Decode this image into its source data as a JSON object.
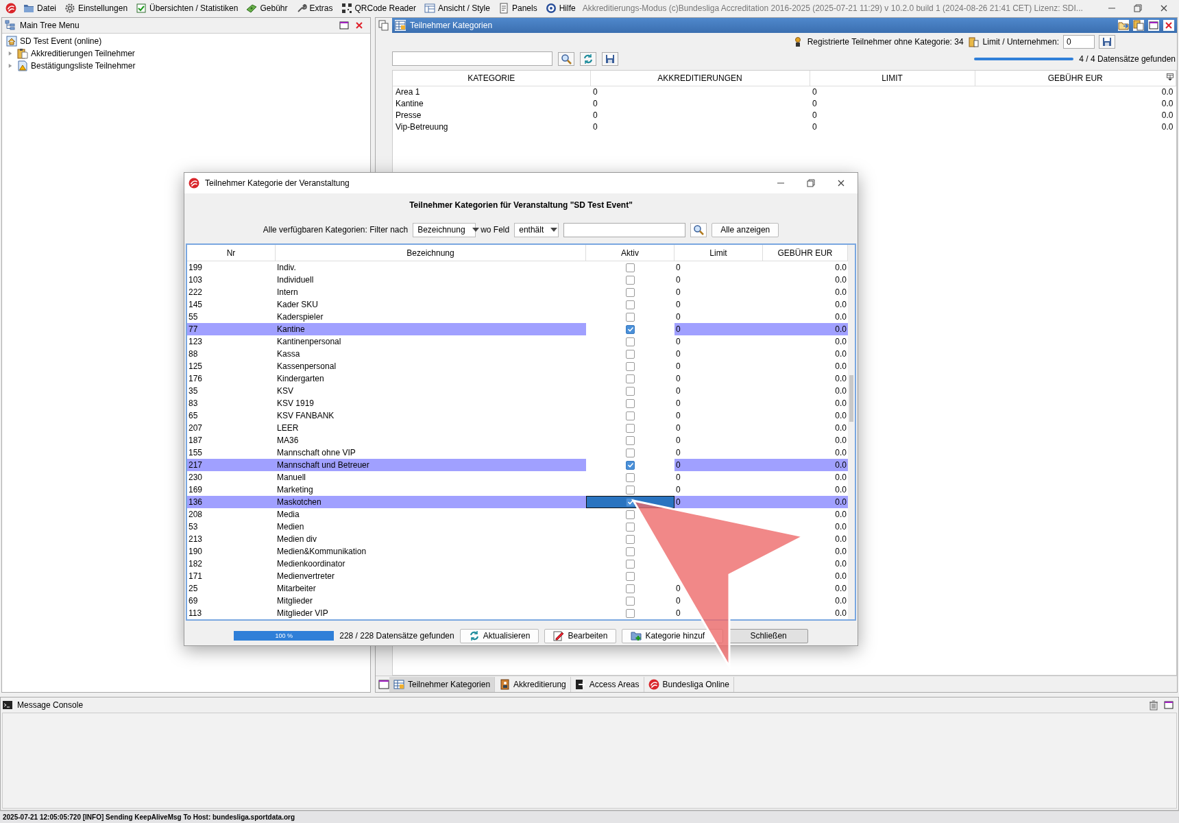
{
  "menu_bar": {
    "items": [
      {
        "label": "Datei"
      },
      {
        "label": "Einstellungen"
      },
      {
        "label": "Übersichten / Statistiken"
      },
      {
        "label": "Gebühr"
      },
      {
        "label": "Extras"
      },
      {
        "label": "QRCode Reader"
      },
      {
        "label": "Ansicht / Style"
      },
      {
        "label": "Panels"
      },
      {
        "label": "Hilfe"
      }
    ],
    "app_title": "Akkreditierungs-Modus (c)Bundesliga Accreditation 2016-2025 (2025-07-21 11:29) v 10.2.0 build 1 (2024-08-26 21:41 CET) Lizenz: SDI..."
  },
  "tree_panel": {
    "title": "Main Tree Menu",
    "root": "SD Test Event (online)",
    "items": [
      {
        "label": "Akkreditierungen Teilnehmer",
        "expanded": false
      },
      {
        "label": "Bestätigungsliste Teilnehmer",
        "expanded": false
      }
    ]
  },
  "main_panel": {
    "title": "Teilnehmer Kategorien",
    "info": "Registrierte Teilnehmer ohne Kategorie: 34",
    "limit_label": "Limit / Unternehmen:",
    "limit_value": "0",
    "progress": {
      "level": 1
    },
    "records": "4 / 4 Datensätze gefunden",
    "columns": [
      "KATEGORIE",
      "AKKREDITIERUNGEN",
      "LIMIT",
      "GEBÜHR EUR"
    ],
    "rows": [
      {
        "category": "Area 1",
        "accreditations": "0",
        "limit": "0",
        "fee": "0.0"
      },
      {
        "category": "Kantine",
        "accreditations": "0",
        "limit": "0",
        "fee": "0.0"
      },
      {
        "category": "Presse",
        "accreditations": "0",
        "limit": "0",
        "fee": "0.0"
      },
      {
        "category": "Vip-Betreuung",
        "accreditations": "0",
        "limit": "0",
        "fee": "0.0"
      }
    ],
    "tabs": [
      {
        "label": "Teilnehmer Kategorien",
        "selected": true
      },
      {
        "label": "Akkreditierung",
        "selected": false
      },
      {
        "label": "Access Areas",
        "selected": false
      },
      {
        "label": "Bundesliga Online",
        "selected": false
      }
    ]
  },
  "dialog": {
    "title": "Teilnehmer Kategorie der Veranstaltung",
    "heading": "Teilnehmer Kategorien für Veranstaltung \"SD Test Event\"",
    "filter_label": "Alle verfügbaren Kategorien: Filter nach",
    "field_select": "Bezeichnung",
    "field_label": "wo Feld",
    "operator_select": "enthält",
    "show_all_button": "Alle anzeigen",
    "columns": [
      "Nr",
      "Bezeichnung",
      "Aktiv",
      "Limit",
      "GEBÜHR EUR"
    ],
    "rows": [
      {
        "nr": "199",
        "name": "Indiv.",
        "active": false,
        "limit": "0",
        "fee": "0.0",
        "selected": false,
        "focused": false
      },
      {
        "nr": "103",
        "name": "Individuell",
        "active": false,
        "limit": "0",
        "fee": "0.0",
        "selected": false,
        "focused": false
      },
      {
        "nr": "222",
        "name": "Intern",
        "active": false,
        "limit": "0",
        "fee": "0.0",
        "selected": false,
        "focused": false
      },
      {
        "nr": "145",
        "name": "Kader SKU",
        "active": false,
        "limit": "0",
        "fee": "0.0",
        "selected": false,
        "focused": false
      },
      {
        "nr": "55",
        "name": "Kaderspieler",
        "active": false,
        "limit": "0",
        "fee": "0.0",
        "selected": false,
        "focused": false
      },
      {
        "nr": "77",
        "name": "Kantine",
        "active": true,
        "limit": "0",
        "fee": "0.0",
        "selected": true,
        "focused": false
      },
      {
        "nr": "123",
        "name": "Kantinenpersonal",
        "active": false,
        "limit": "0",
        "fee": "0.0",
        "selected": false,
        "focused": false
      },
      {
        "nr": "88",
        "name": "Kassa",
        "active": false,
        "limit": "0",
        "fee": "0.0",
        "selected": false,
        "focused": false
      },
      {
        "nr": "125",
        "name": "Kassenpersonal",
        "active": false,
        "limit": "0",
        "fee": "0.0",
        "selected": false,
        "focused": false
      },
      {
        "nr": "176",
        "name": "Kindergarten",
        "active": false,
        "limit": "0",
        "fee": "0.0",
        "selected": false,
        "focused": false
      },
      {
        "nr": "35",
        "name": "KSV",
        "active": false,
        "limit": "0",
        "fee": "0.0",
        "selected": false,
        "focused": false
      },
      {
        "nr": "83",
        "name": "KSV 1919",
        "active": false,
        "limit": "0",
        "fee": "0.0",
        "selected": false,
        "focused": false
      },
      {
        "nr": "65",
        "name": "KSV FANBANK",
        "active": false,
        "limit": "0",
        "fee": "0.0",
        "selected": false,
        "focused": false
      },
      {
        "nr": "207",
        "name": "LEER",
        "active": false,
        "limit": "0",
        "fee": "0.0",
        "selected": false,
        "focused": false
      },
      {
        "nr": "187",
        "name": "MA36",
        "active": false,
        "limit": "0",
        "fee": "0.0",
        "selected": false,
        "focused": false
      },
      {
        "nr": "155",
        "name": "Mannschaft ohne VIP",
        "active": false,
        "limit": "0",
        "fee": "0.0",
        "selected": false,
        "focused": false
      },
      {
        "nr": "217",
        "name": "Mannschaft und Betreuer",
        "active": true,
        "limit": "0",
        "fee": "0.0",
        "selected": true,
        "focused": false
      },
      {
        "nr": "230",
        "name": "Manuell",
        "active": false,
        "limit": "0",
        "fee": "0.0",
        "selected": false,
        "focused": false
      },
      {
        "nr": "169",
        "name": "Marketing",
        "active": false,
        "limit": "0",
        "fee": "0.0",
        "selected": false,
        "focused": false
      },
      {
        "nr": "136",
        "name": "Maskotchen",
        "active": true,
        "limit": "0",
        "fee": "0.0",
        "selected": true,
        "focused": true
      },
      {
        "nr": "208",
        "name": "Media",
        "active": false,
        "fee": "0.0",
        "selected": false,
        "focused": false
      },
      {
        "nr": "53",
        "name": "Medien",
        "active": false,
        "fee": "0.0",
        "selected": false,
        "focused": false
      },
      {
        "nr": "213",
        "name": "Medien div",
        "active": false,
        "fee": "0.0",
        "selected": false,
        "focused": false
      },
      {
        "nr": "190",
        "name": "Medien&Kommunikation",
        "active": false,
        "fee": "0.0",
        "selected": false,
        "focused": false
      },
      {
        "nr": "182",
        "name": "Medienkoordinator",
        "active": false,
        "fee": "0.0",
        "selected": false,
        "focused": false
      },
      {
        "nr": "171",
        "name": "Medienvertreter",
        "active": false,
        "fee": "0.0",
        "selected": false,
        "focused": false
      },
      {
        "nr": "25",
        "name": "Mitarbeiter",
        "active": false,
        "limit": "0",
        "fee": "0.0",
        "selected": false,
        "focused": false
      },
      {
        "nr": "69",
        "name": "Mitglieder",
        "active": false,
        "limit": "0",
        "fee": "0.0",
        "selected": false,
        "focused": false
      },
      {
        "nr": "113",
        "name": "Mitglieder VIP",
        "active": false,
        "limit": "0",
        "fee": "0.0",
        "selected": false,
        "focused": false
      }
    ],
    "progress": {
      "level": 1,
      "label": "100 %"
    },
    "records": "228 / 228 Datensätze gefunden",
    "buttons": [
      {
        "label": "Aktualisieren",
        "default": false
      },
      {
        "label": "Bearbeiten",
        "default": false
      },
      {
        "label": "Kategorie hinzuf",
        "default": false
      },
      {
        "label": "Schließen",
        "default": true
      }
    ]
  },
  "console": {
    "title": "Message Console"
  },
  "status_bar": {
    "text": "2025-07-21 12:05:05:720 [INFO] Sending KeepAliveMsg To Host: bundesliga.sportdata.org"
  }
}
